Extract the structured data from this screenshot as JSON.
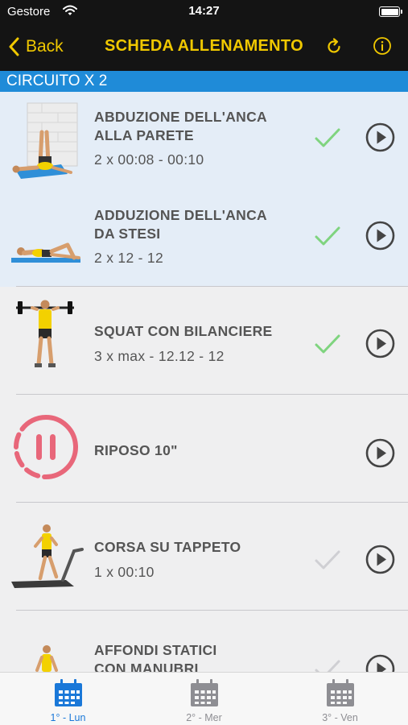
{
  "status_bar": {
    "carrier": "Gestore",
    "time": "14:27"
  },
  "nav": {
    "back_label": "Back",
    "title": "SCHEDA ALLENAMENTO"
  },
  "section": {
    "title": "CIRCUITO X 2"
  },
  "exercises": [
    {
      "name_line1": "ABDUZIONE DELL'ANCA",
      "name_line2": "ALLA PARETE",
      "sets": "2 x 00:08 - 00:10",
      "completed": true,
      "icon": "wall-hip-abduction-image"
    },
    {
      "name_line1": "ADDUZIONE DELL'ANCA",
      "name_line2": "DA STESI",
      "sets": "2 x 12 - 12",
      "completed": true,
      "icon": "lying-hip-adduction-image"
    },
    {
      "name_line1": "SQUAT CON BILANCIERE",
      "name_line2": "",
      "sets": "3 x max - 12.12 - 12",
      "completed": true,
      "icon": "barbell-squat-image"
    },
    {
      "name_line1": "RIPOSO 10\"",
      "name_line2": "",
      "sets": "",
      "completed": false,
      "icon": "rest-pause-icon"
    },
    {
      "name_line1": "CORSA SU TAPPETO",
      "name_line2": "",
      "sets": "1 x 00:10",
      "completed": false,
      "icon": "treadmill-run-image"
    },
    {
      "name_line1": "AFFONDI STATICI",
      "name_line2": "CON MANUBRI",
      "sets": "",
      "completed": false,
      "icon": "dumbbell-lunge-image"
    }
  ],
  "tabs": [
    {
      "label": "1° - Lun",
      "active": true
    },
    {
      "label": "2° - Mer",
      "active": false
    },
    {
      "label": "3° - Ven",
      "active": false
    }
  ],
  "colors": {
    "accent": "#f0c800",
    "section_bg": "#1f8bd8",
    "check_done": "#7fd47f",
    "check_pending": "#cfcfd3",
    "rest_red": "#e8677a",
    "tab_active": "#1a78d8"
  }
}
